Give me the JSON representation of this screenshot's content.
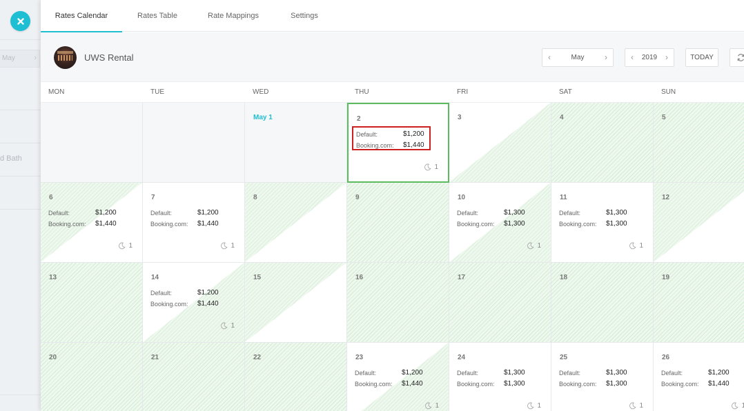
{
  "background": {
    "month_label": "May",
    "partial_text": "d Bath"
  },
  "tabs": [
    {
      "label": "Rates Calendar",
      "active": true
    },
    {
      "label": "Rates Table",
      "active": false
    },
    {
      "label": "Rate Mappings",
      "active": false
    },
    {
      "label": "Settings",
      "active": false
    }
  ],
  "property": {
    "name": "UWS Rental"
  },
  "controls": {
    "month": "May",
    "year": "2019",
    "today_label": "TODAY"
  },
  "weekdays": [
    "MON",
    "TUE",
    "WED",
    "THU",
    "FRI",
    "SAT",
    "SUN"
  ],
  "rate_labels": {
    "default": "Default:",
    "booking": "Booking.com:"
  },
  "colors": {
    "accent": "#1fbfd3",
    "selected_border": "#5cba5f",
    "highlight_border": "#cc1f1f",
    "blocked_fill": "#eef8ee"
  },
  "weeks": [
    [
      {
        "date": "",
        "empty": true
      },
      {
        "date": "",
        "empty": true
      },
      {
        "date": "May 1",
        "empty": true,
        "month_start": true
      },
      {
        "date": "2",
        "default": "$1,200",
        "booking": "$1,440",
        "nights": "1",
        "selected": true,
        "highlighted": true
      },
      {
        "date": "3",
        "diag": "left"
      },
      {
        "date": "4",
        "blocked": true
      },
      {
        "date": "5",
        "blocked": true
      }
    ],
    [
      {
        "date": "6",
        "default": "$1,200",
        "booking": "$1,440",
        "nights": "1",
        "diag": "right"
      },
      {
        "date": "7",
        "default": "$1,200",
        "booking": "$1,440",
        "nights": "1"
      },
      {
        "date": "8",
        "diag": "right"
      },
      {
        "date": "9",
        "blocked": true
      },
      {
        "date": "10",
        "default": "$1,300",
        "booking": "$1,300",
        "nights": "1",
        "diag": "left"
      },
      {
        "date": "11",
        "default": "$1,300",
        "booking": "$1,300",
        "nights": "1"
      },
      {
        "date": "12",
        "diag": "right"
      }
    ],
    [
      {
        "date": "13",
        "blocked": true
      },
      {
        "date": "14",
        "default": "$1,200",
        "booking": "$1,440",
        "nights": "1",
        "diag": "left"
      },
      {
        "date": "15",
        "diag": "right"
      },
      {
        "date": "16",
        "blocked": true
      },
      {
        "date": "17",
        "blocked": true
      },
      {
        "date": "18",
        "blocked": true
      },
      {
        "date": "19",
        "blocked": true
      }
    ],
    [
      {
        "date": "20",
        "blocked": true
      },
      {
        "date": "21",
        "blocked": true
      },
      {
        "date": "22",
        "blocked": true
      },
      {
        "date": "23",
        "default": "$1,200",
        "booking": "$1,440",
        "nights": "1",
        "diag": "left"
      },
      {
        "date": "24",
        "default": "$1,300",
        "booking": "$1,300",
        "nights": "1"
      },
      {
        "date": "25",
        "default": "$1,300",
        "booking": "$1,300",
        "nights": "1"
      },
      {
        "date": "26",
        "default": "$1,200",
        "booking": "$1,440",
        "nights": "1"
      }
    ]
  ]
}
